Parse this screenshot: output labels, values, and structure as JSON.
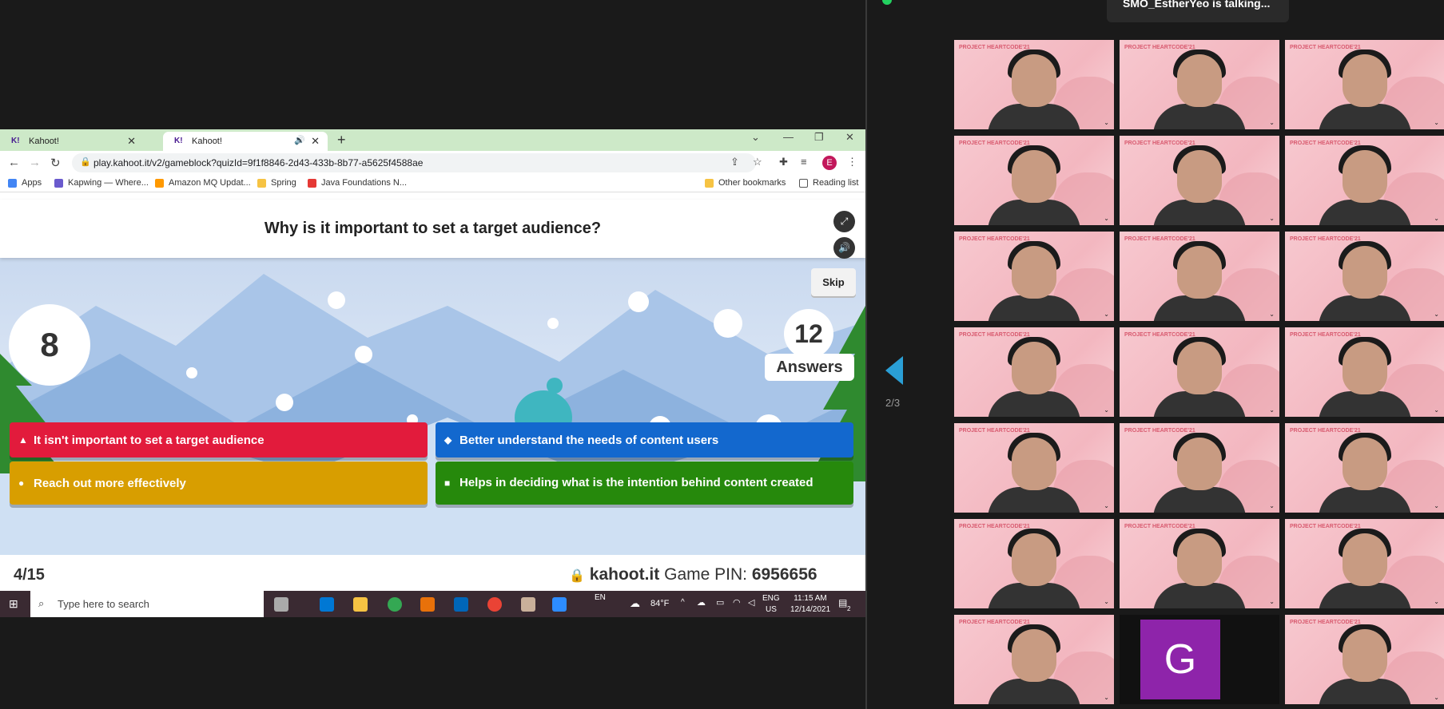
{
  "chrome": {
    "tabs": [
      {
        "title": "Kahoot!",
        "active": false
      },
      {
        "title": "Kahoot!",
        "active": true
      }
    ],
    "url": "play.kahoot.it/v2/gameblock?quizId=9f1f8846-2d43-433b-8b77-a5625f4588ae",
    "profile_initial": "E",
    "bookmarks": [
      {
        "label": "Apps",
        "color": "#4285f4"
      },
      {
        "label": "Kapwing — Where...",
        "color": "#6a5acd"
      },
      {
        "label": "Amazon MQ Updat...",
        "color": "#ff9900"
      },
      {
        "label": "Spring",
        "color": "#f6c343"
      },
      {
        "label": "Java Foundations N...",
        "color": "#e53935"
      }
    ],
    "other_bookmarks": "Other bookmarks",
    "reading_list": "Reading list"
  },
  "kahoot": {
    "question": "Why is it important to set a target audience?",
    "skip_label": "Skip",
    "timer": "8",
    "answer_count": "12",
    "answers_label": "Answers",
    "answers": [
      {
        "text": "It isn't important to set a target audience",
        "shape": "▲",
        "color": "#e21b3c"
      },
      {
        "text": "Better understand the needs of content users",
        "shape": "◆",
        "color": "#1368ce"
      },
      {
        "text": "Reach out more effectively",
        "shape": "●",
        "color": "#d89e00"
      },
      {
        "text": "Helps in deciding what is the intention behind content created",
        "shape": "■",
        "color": "#26890c"
      }
    ],
    "progress": "4/15",
    "site": "kahoot.it",
    "pin_label": "Game PIN:",
    "pin": "6956656"
  },
  "taskbar": {
    "search_placeholder": "Type here to search",
    "lang_top": "EN",
    "lang": "ENG",
    "region": "US",
    "weather": "84°F",
    "time": "11:15 AM",
    "date": "12/14/2021",
    "notification_count": "2"
  },
  "zoom": {
    "talking": "SMO_EstherYeo is talking...",
    "page_indicator": "2/3",
    "g_initial": "G",
    "tile_brand": "PROJECT HEARTCODE'21",
    "accent": "#2a9fd6"
  }
}
